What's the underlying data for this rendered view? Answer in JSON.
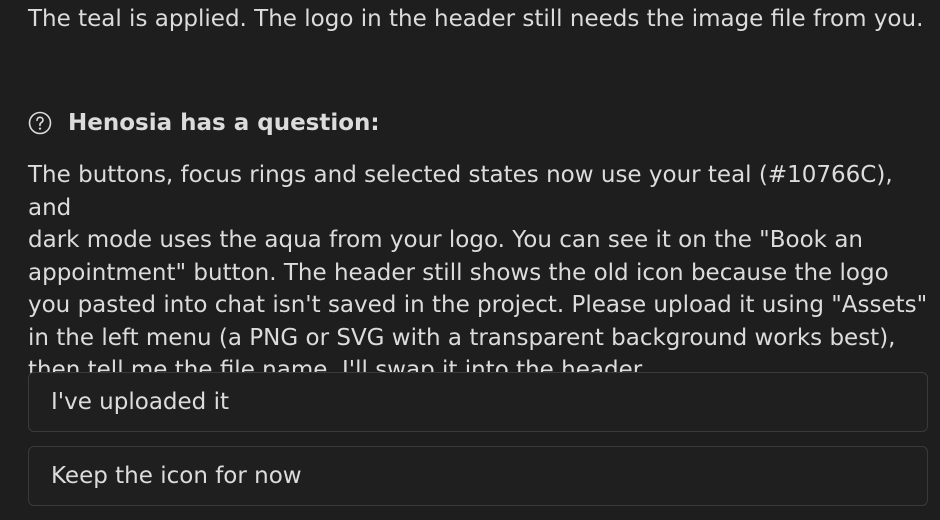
{
  "message": {
    "intro": "The teal is applied. The logo in the header still needs the image file from you."
  },
  "question": {
    "icon": "help-circle-icon",
    "title": "Henosia has a question:",
    "body_lines": [
      "The buttons, focus rings and selected states now use your teal (#10766C), and",
      "dark mode uses the aqua from your logo. You can see it on the \"Book an",
      "appointment\" button. The header still shows the old icon because the logo",
      "you pasted into chat isn't saved in the project. Please upload it using \"Assets\"",
      "in the left menu (a PNG or SVG with a transparent background works best),",
      "then tell me the file name. I'll swap it into the header."
    ]
  },
  "options": [
    {
      "label": "I've uploaded it"
    },
    {
      "label": "Keep the icon for now"
    }
  ]
}
